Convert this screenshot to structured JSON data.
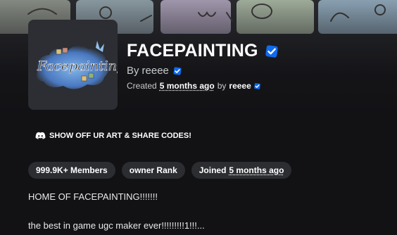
{
  "group": {
    "title": "FACEPAINTING",
    "verified": true,
    "by_label": "By",
    "owner": "reeee",
    "created_label": "Created",
    "created_ago": "5 months ago",
    "created_by_label": "by",
    "created_by": "reeee"
  },
  "social": {
    "icon": "discord-icon",
    "label": "SHOW OFF UR ART & SHARE CODES!"
  },
  "pills": {
    "members": "999.9K+ Members",
    "rank": "owner Rank",
    "joined_label": "Joined",
    "joined_ago": "5 months ago"
  },
  "description": {
    "line1": "HOME OF FACEPAINTING!!!!!!!",
    "line2": "the best in game ugc maker ever!!!!!!!!!1!!!..."
  },
  "colors": {
    "background": "#121215",
    "pill": "#2b2d31",
    "verified_badge": "#0f6bf0"
  }
}
